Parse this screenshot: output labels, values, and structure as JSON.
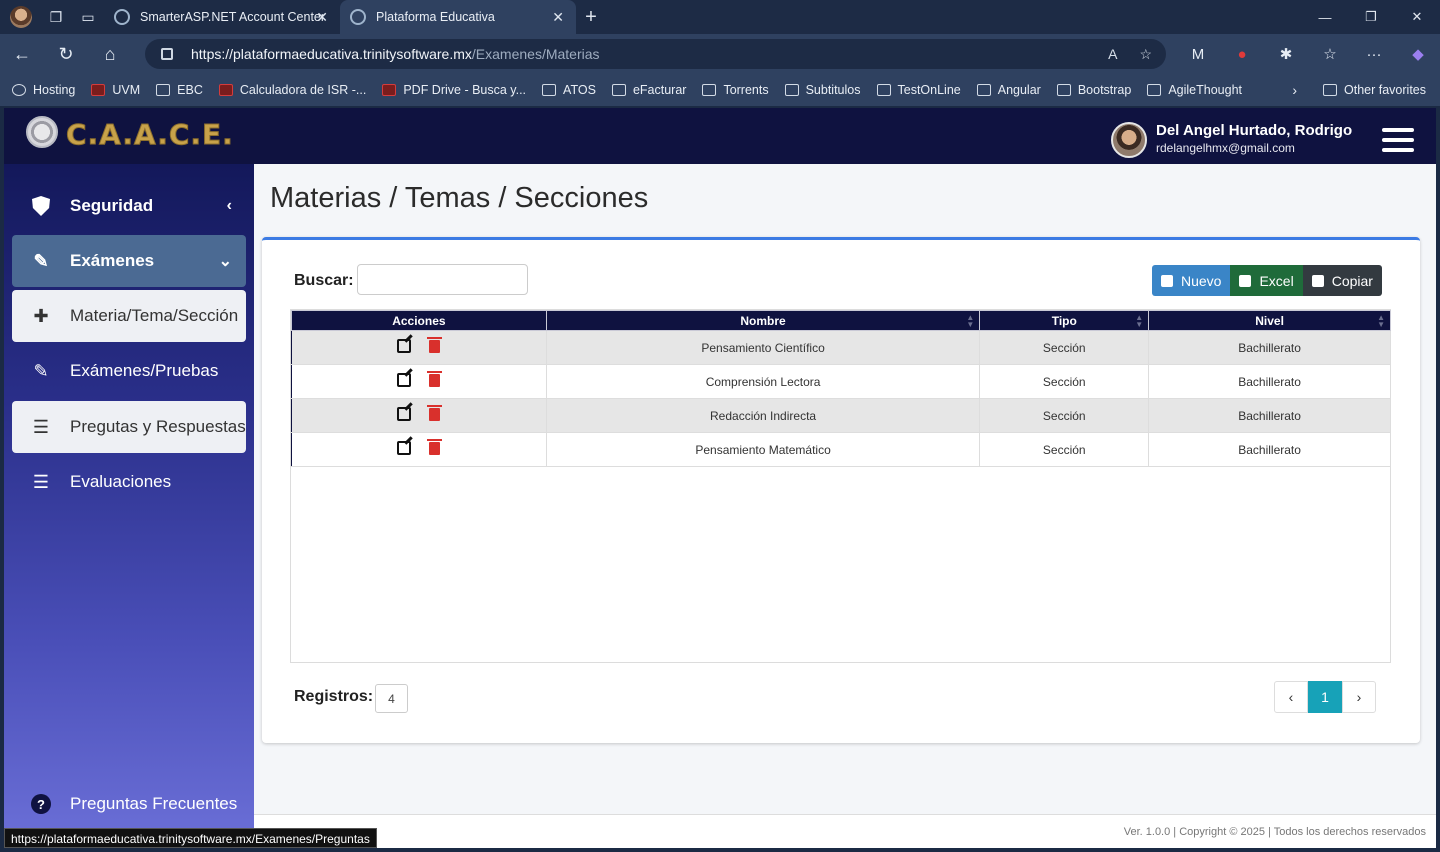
{
  "browser": {
    "tabs": [
      {
        "title": "SmarterASP.NET Account Center"
      },
      {
        "title": "Plataforma Educativa"
      }
    ],
    "url_host": "https://plataformaeducativa.trinitysoftware.mx",
    "url_path": "/Examenes/Materias",
    "favorites": [
      "Hosting",
      "UVM",
      "EBC",
      "Calculadora de ISR -...",
      "PDF Drive - Busca y...",
      "ATOS",
      "eFacturar",
      "Torrents",
      "Subtitulos",
      "TestOnLine",
      "Angular",
      "Bootstrap",
      "AgileThought"
    ],
    "other_favorites": "Other favorites",
    "status_url": "https://plataformaeducativa.trinitysoftware.mx/Examenes/Preguntas"
  },
  "app": {
    "logo_text": "C.A.A.C.E.",
    "user_name": "Del Angel Hurtado, Rodrigo",
    "user_email": "rdelangelhmx@gmail.com"
  },
  "sidebar": {
    "items": [
      {
        "label": "Seguridad"
      },
      {
        "label": "Exámenes"
      },
      {
        "label": "Materia/Tema/Sección"
      },
      {
        "label": "Exámenes/Pruebas"
      },
      {
        "label": "Pregutas y Respuestas"
      },
      {
        "label": "Evaluaciones"
      },
      {
        "label": "Preguntas Frecuentes"
      }
    ]
  },
  "page": {
    "title": "Materias / Temas / Secciones",
    "search_label": "Buscar:",
    "buttons": {
      "nuevo": "Nuevo",
      "excel": "Excel",
      "copiar": "Copiar"
    },
    "table": {
      "headers": [
        "Acciones",
        "Nombre",
        "Tipo",
        "Nivel"
      ],
      "rows": [
        {
          "nombre": "Pensamiento Científico",
          "tipo": "Sección",
          "nivel": "Bachillerato"
        },
        {
          "nombre": "Comprensión Lectora",
          "tipo": "Sección",
          "nivel": "Bachillerato"
        },
        {
          "nombre": "Redacción Indirecta",
          "tipo": "Sección",
          "nivel": "Bachillerato"
        },
        {
          "nombre": "Pensamiento Matemático",
          "tipo": "Sección",
          "nivel": "Bachillerato"
        }
      ]
    },
    "records_label": "Registros:",
    "records_count": "4",
    "current_page": "1"
  },
  "footer": {
    "text": "Ver. 1.0.0 | Copyright © 2025 | Todos los derechos reservados"
  },
  "colors": {
    "topnav": "#0f1240",
    "accent": "#3c7be4",
    "pager_active": "#17a2b8",
    "delete_red": "#d9302c"
  }
}
